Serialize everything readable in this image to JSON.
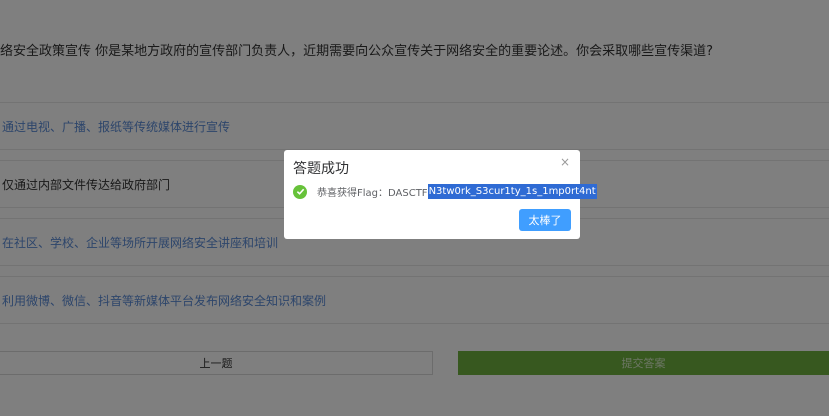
{
  "question": {
    "text": "络安全政策宣传 你是某地方政府的宣传部门负责人，近期需要向公众宣传关于网络安全的重要论述。你会采取哪些宣传渠道?"
  },
  "options": [
    {
      "label": "通过电视、广播、报纸等传统媒体进行宣传"
    },
    {
      "label": "仅通过内部文件传达给政府部门"
    },
    {
      "label": "在社区、学校、企业等场所开展网络安全讲座和培训"
    },
    {
      "label": "利用微博、微信、抖音等新媒体平台发布网络安全知识和案例"
    }
  ],
  "buttons": {
    "prev_label": "上一题",
    "submit_label": "提交答案"
  },
  "dialog": {
    "title": "答题成功",
    "close_glyph": "×",
    "message_prefix": "恭喜获得Flag：DASCTF",
    "flag_selected": "N3tw0rk_S3cur1ty_1s_1mp0rt4nt",
    "ok_label": "太棒了"
  },
  "colors": {
    "success": "#67c23a",
    "primary": "#409eff",
    "submit": "#6fb03e",
    "selection": "#2f6bd4"
  }
}
